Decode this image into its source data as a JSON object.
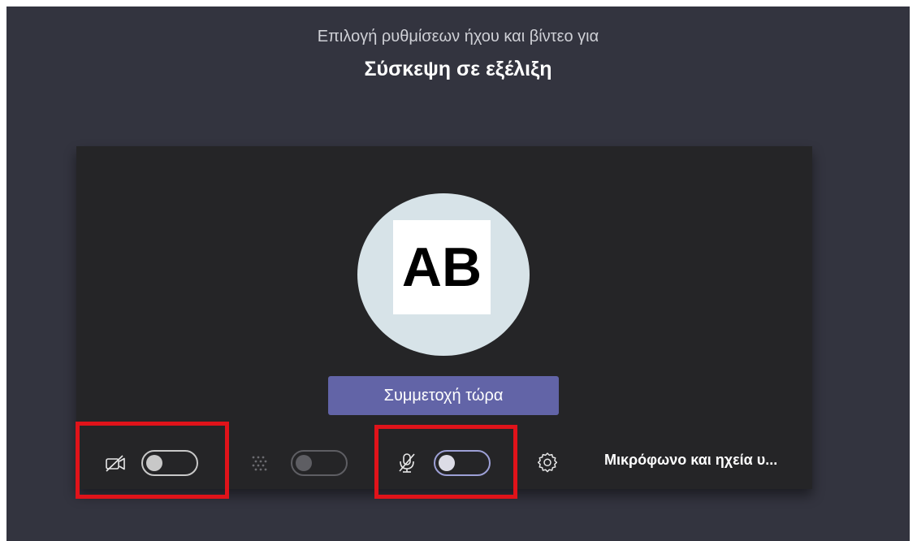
{
  "header": {
    "subtitle": "Επιλογή ρυθμίσεων ήχου και βίντεο για",
    "meeting_title": "Σύσκεψη σε εξέλιξη"
  },
  "preview": {
    "avatar_initials": "AB",
    "join_button_label": "Συμμετοχή τώρα"
  },
  "controls": {
    "camera": {
      "icon": "camera-off-icon",
      "state": "off"
    },
    "background_effects": {
      "icon": "background-blur-icon",
      "state": "off",
      "enabled": false
    },
    "microphone": {
      "icon": "mic-off-icon",
      "state": "off"
    },
    "device_settings": {
      "icon": "gear-icon",
      "label": "Μικρόφωνο και ηχεία υ..."
    }
  },
  "colors": {
    "background": "#33343f",
    "preview_background": "#252527",
    "join_button": "#6264a7",
    "avatar_circle": "#d7e3e8",
    "highlight": "#e0131a"
  }
}
